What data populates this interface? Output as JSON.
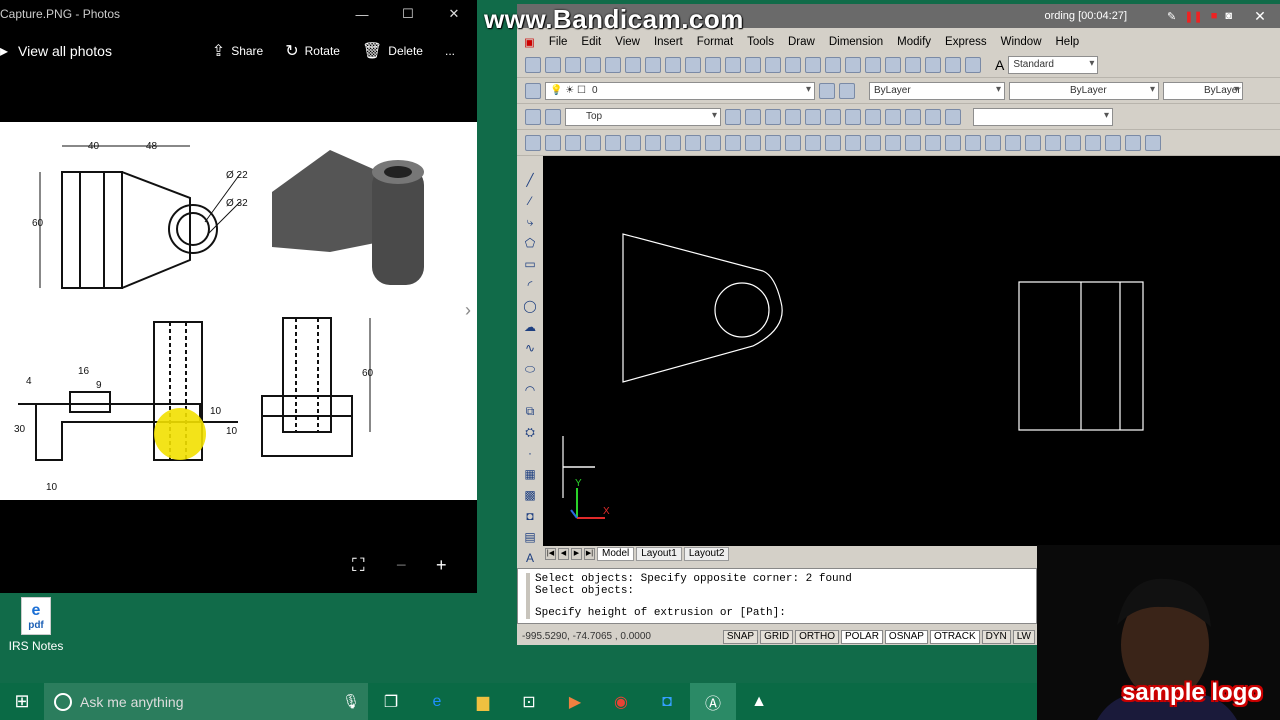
{
  "watermark": "www.Bandicam.com",
  "photos": {
    "title": "Capture.PNG - Photos",
    "view_all": "View all photos",
    "actions": {
      "share": "Share",
      "rotate": "Rotate",
      "delete": "Delete",
      "more": "..."
    },
    "drawing_labels": {
      "dim40": "40",
      "dim48": "48",
      "dim60a": "60",
      "d22": "Ø 22",
      "d32": "Ø 32",
      "dim16": "16",
      "dim9": "9",
      "dim4": "4",
      "dim30": "30",
      "dim10a": "10",
      "dim10b": "10",
      "dim10c": "10",
      "dim60b": "60"
    }
  },
  "desktop_icon": {
    "label": "IRS Notes",
    "badge": "pdf"
  },
  "taskbar": {
    "search_placeholder": "Ask me anything"
  },
  "recorder": {
    "status": "ording [00:04:27]"
  },
  "autocad": {
    "menu": [
      "File",
      "Edit",
      "View",
      "Insert",
      "Format",
      "Tools",
      "Draw",
      "Dimension",
      "Modify",
      "Express",
      "Window",
      "Help"
    ],
    "text_style": "Standard",
    "layer": "0",
    "color": "ByLayer",
    "linetype": "ByLayer",
    "lineweight": "ByLayer",
    "view": "Top",
    "tabs": [
      "Model",
      "Layout1",
      "Layout2"
    ],
    "active_tab": "Model",
    "command_lines": [
      "Select objects: Specify opposite corner: 2 found",
      "Select objects:",
      "",
      "Specify height of extrusion or [Path]:"
    ],
    "coords": "-995.5290, -74.7065 , 0.0000",
    "status_buttons": [
      "SNAP",
      "GRID",
      "ORTHO",
      "POLAR",
      "OSNAP",
      "OTRACK",
      "DYN",
      "LW"
    ],
    "ucs": {
      "x": "X",
      "y": "Y"
    }
  },
  "webcam_logo": "sample logo"
}
